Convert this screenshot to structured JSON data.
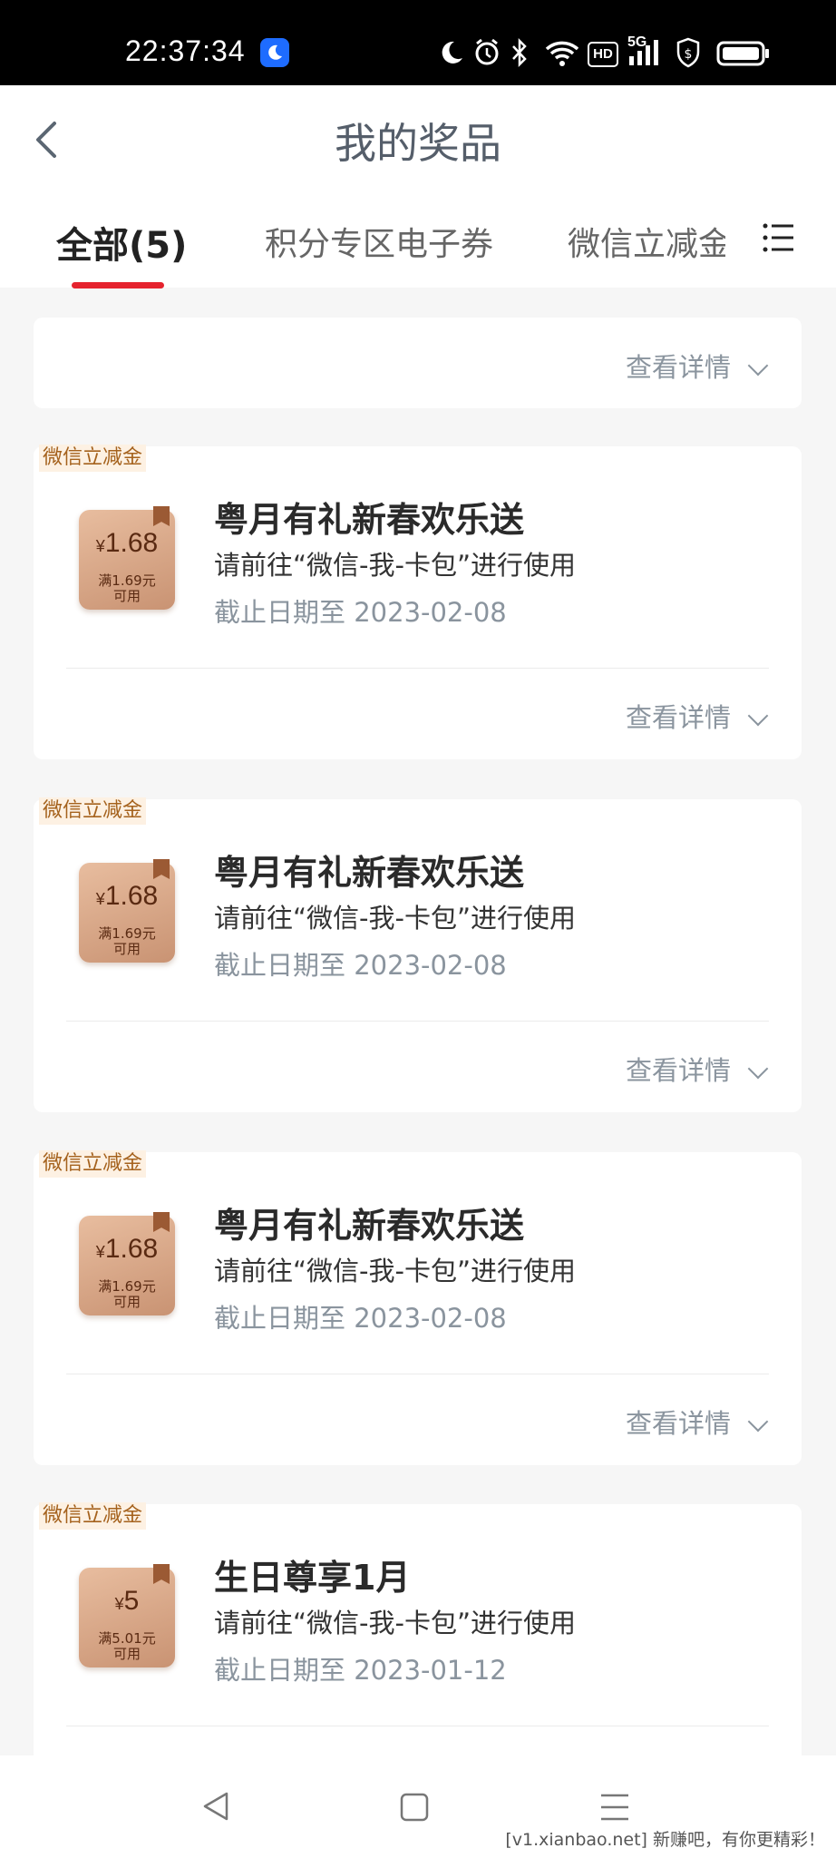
{
  "status_bar": {
    "time": "22:37:34",
    "network": "5G",
    "hd": "HD"
  },
  "header": {
    "title": "我的奖品"
  },
  "tabs": [
    "全部(5)",
    "积分专区电子券",
    "微信立减金("
  ],
  "detail_label": "查看详情",
  "prizes": [
    {
      "tag": "微信立减金",
      "amount": "1.68",
      "currency": "¥",
      "condition_line1": "满1.69元",
      "condition_line2": "可用",
      "name": "粤月有礼新春欢乐送",
      "desc": "请前往“微信-我-卡包”进行使用",
      "date": "截止日期至 2023-02-08",
      "detail": "查看详情"
    },
    {
      "tag": "微信立减金",
      "amount": "1.68",
      "currency": "¥",
      "condition_line1": "满1.69元",
      "condition_line2": "可用",
      "name": "粤月有礼新春欢乐送",
      "desc": "请前往“微信-我-卡包”进行使用",
      "date": "截止日期至 2023-02-08",
      "detail": "查看详情"
    },
    {
      "tag": "微信立减金",
      "amount": "1.68",
      "currency": "¥",
      "condition_line1": "满1.69元",
      "condition_line2": "可用",
      "name": "粤月有礼新春欢乐送",
      "desc": "请前往“微信-我-卡包”进行使用",
      "date": "截止日期至 2023-02-08",
      "detail": "查看详情"
    },
    {
      "tag": "微信立减金",
      "amount": "5",
      "currency": "¥",
      "condition_line1": "满5.01元",
      "condition_line2": "可用",
      "name": "生日尊享1月",
      "desc": "请前往“微信-我-卡包”进行使用",
      "date": "截止日期至 2023-01-12"
    }
  ],
  "footer": "[v1.xianbao.net] 新赚吧，有你更精彩！",
  "colors": {
    "accent": "#e5232e",
    "tag_text": "#a5621d",
    "coupon": "#d3a283"
  }
}
